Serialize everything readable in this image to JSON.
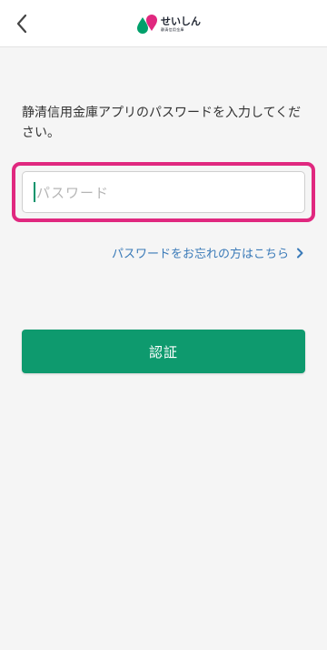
{
  "header": {
    "back_icon": "chevron-left-icon",
    "logo_text": "せいしん",
    "logo_subtext": "静清信用金庫",
    "brand_colors": {
      "green": "#00a06b",
      "pink": "#e0287f"
    }
  },
  "main": {
    "prompt": "静清信用金庫アプリのパスワードを入力してください。",
    "password_placeholder": "パスワード",
    "password_value": "",
    "forgot_link": "パスワードをお忘れの方はこちら",
    "submit_label": "認証"
  },
  "colors": {
    "accent": "#0e9a6e",
    "link": "#3a7ab8",
    "highlight": "#e0287f"
  }
}
